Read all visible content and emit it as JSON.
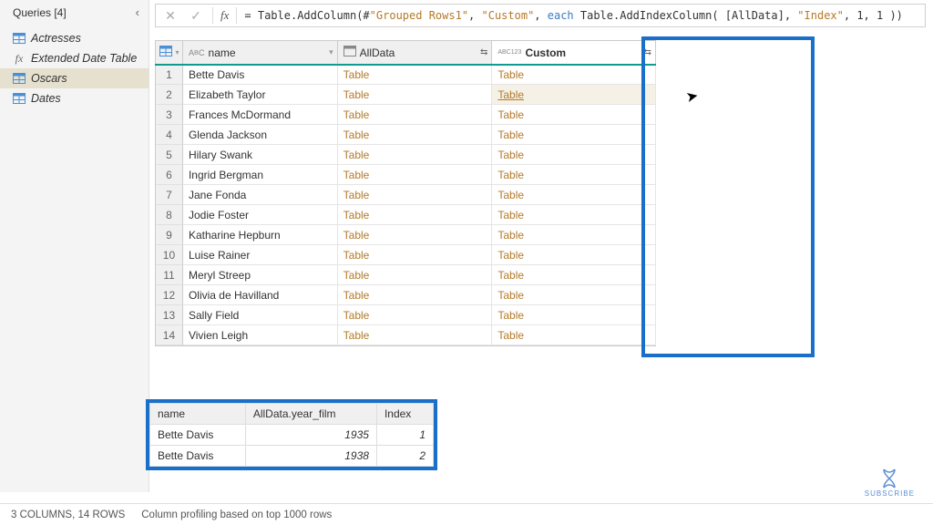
{
  "sidebar": {
    "title": "Queries [4]",
    "items": [
      {
        "label": "Actresses",
        "icon": "table"
      },
      {
        "label": "Extended Date Table",
        "icon": "fx"
      },
      {
        "label": "Oscars",
        "icon": "table",
        "selected": true
      },
      {
        "label": "Dates",
        "icon": "table"
      }
    ]
  },
  "formula_bar": {
    "prefix": "= Table.AddColumn(#",
    "str1": "\"Grouped Rows1\"",
    "sep1": ", ",
    "str2": "\"Custom\"",
    "sep2": ", ",
    "kw_each": "each",
    "mid": " Table.AddIndexColumn( [AllData], ",
    "str3": "\"Index\"",
    "tail": ", 1, 1 ))"
  },
  "columns": {
    "name": "name",
    "alldata": "AllData",
    "custom": "Custom"
  },
  "rows": [
    {
      "n": "1",
      "name": "Bette Davis",
      "alldata": "Table",
      "custom": "Table"
    },
    {
      "n": "2",
      "name": "Elizabeth Taylor",
      "alldata": "Table",
      "custom": "Table"
    },
    {
      "n": "3",
      "name": "Frances McDormand",
      "alldata": "Table",
      "custom": "Table"
    },
    {
      "n": "4",
      "name": "Glenda Jackson",
      "alldata": "Table",
      "custom": "Table"
    },
    {
      "n": "5",
      "name": "Hilary Swank",
      "alldata": "Table",
      "custom": "Table"
    },
    {
      "n": "6",
      "name": "Ingrid Bergman",
      "alldata": "Table",
      "custom": "Table"
    },
    {
      "n": "7",
      "name": "Jane Fonda",
      "alldata": "Table",
      "custom": "Table"
    },
    {
      "n": "8",
      "name": "Jodie Foster",
      "alldata": "Table",
      "custom": "Table"
    },
    {
      "n": "9",
      "name": "Katharine Hepburn",
      "alldata": "Table",
      "custom": "Table"
    },
    {
      "n": "10",
      "name": "Luise Rainer",
      "alldata": "Table",
      "custom": "Table"
    },
    {
      "n": "11",
      "name": "Meryl Streep",
      "alldata": "Table",
      "custom": "Table"
    },
    {
      "n": "12",
      "name": "Olivia de Havilland",
      "alldata": "Table",
      "custom": "Table"
    },
    {
      "n": "13",
      "name": "Sally Field",
      "alldata": "Table",
      "custom": "Table"
    },
    {
      "n": "14",
      "name": "Vivien Leigh",
      "alldata": "Table",
      "custom": "Table"
    }
  ],
  "preview": {
    "headers": {
      "name": "name",
      "year": "AllData.year_film",
      "index": "Index"
    },
    "rows": [
      {
        "name": "Bette Davis",
        "year": "1935",
        "index": "1"
      },
      {
        "name": "Bette Davis",
        "year": "1938",
        "index": "2"
      }
    ]
  },
  "status": {
    "left": "3 COLUMNS, 14 ROWS",
    "right": "Column profiling based on top 1000 rows"
  },
  "subscribe": {
    "label": "SUBSCRIBE"
  }
}
